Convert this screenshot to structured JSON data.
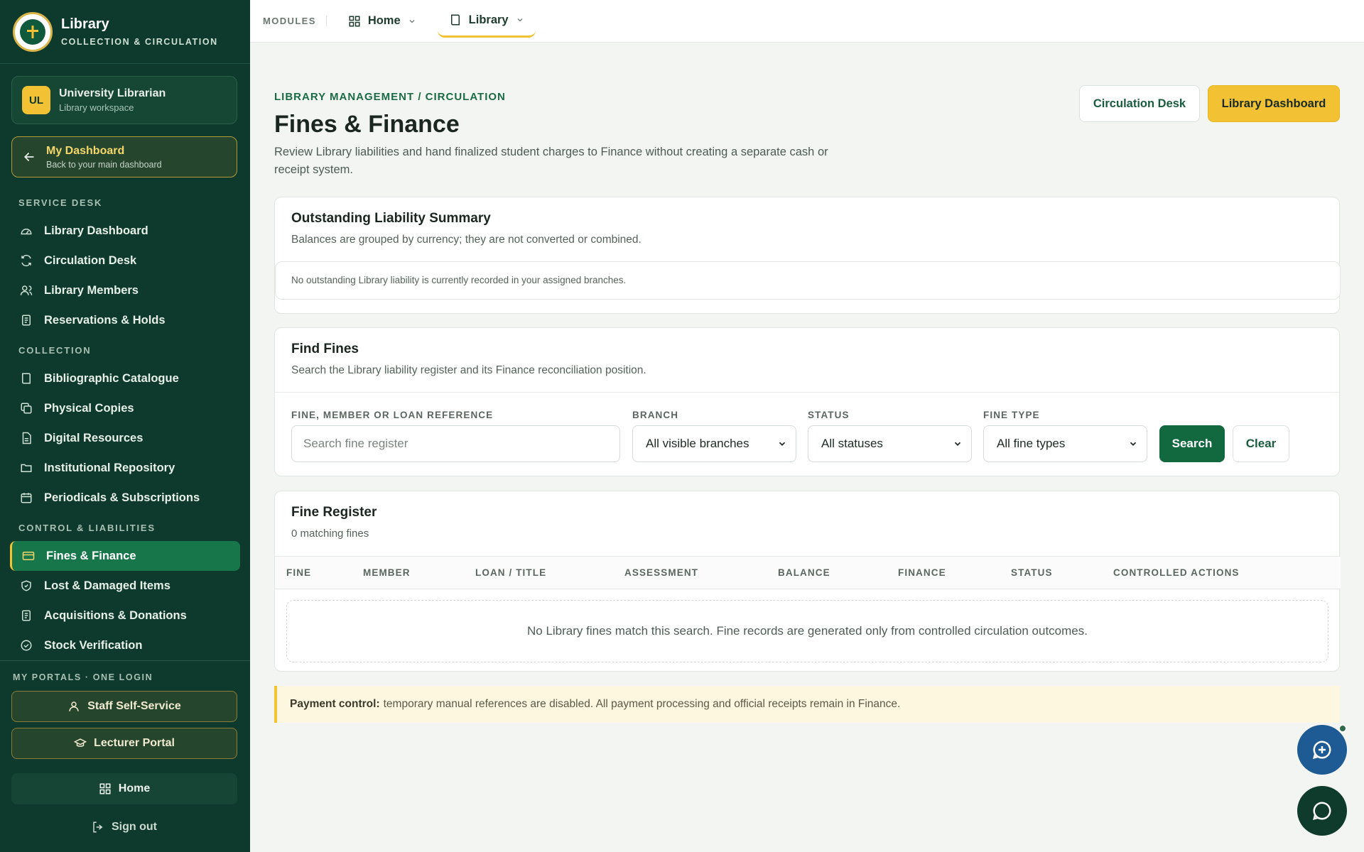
{
  "brand": {
    "title": "Library",
    "subtitle": "COLLECTION & CIRCULATION"
  },
  "user": {
    "initials": "UL",
    "name": "University Librarian",
    "workspace": "Library workspace"
  },
  "dashboard_button": {
    "title": "My Dashboard",
    "subtitle": "Back to your main dashboard"
  },
  "sidebar": {
    "sections": [
      {
        "label": "SERVICE DESK",
        "items": [
          "Library Dashboard",
          "Circulation Desk",
          "Library Members",
          "Reservations & Holds"
        ]
      },
      {
        "label": "COLLECTION",
        "items": [
          "Bibliographic Catalogue",
          "Physical Copies",
          "Digital Resources",
          "Institutional Repository",
          "Periodicals & Subscriptions"
        ]
      },
      {
        "label": "CONTROL & LIABILITIES",
        "items": [
          "Fines & Finance",
          "Lost & Damaged Items",
          "Acquisitions & Donations",
          "Stock Verification"
        ]
      }
    ],
    "active_item": "Fines & Finance"
  },
  "portals": {
    "label": "MY PORTALS · ONE LOGIN",
    "staff": "Staff Self-Service",
    "lecturer": "Lecturer Portal",
    "home": "Home",
    "signout": "Sign out"
  },
  "topbar": {
    "modules_label": "MODULES",
    "tabs": [
      "Home",
      "Library"
    ],
    "active_tab": "Library"
  },
  "header": {
    "breadcrumb": "LIBRARY MANAGEMENT / CIRCULATION",
    "title": "Fines & Finance",
    "description": "Review Library liabilities and hand finalized student charges to Finance without creating a separate cash or receipt system.",
    "circulation_button": "Circulation Desk",
    "dashboard_button": "Library Dashboard"
  },
  "summary": {
    "title": "Outstanding Liability Summary",
    "subtitle": "Balances are grouped by currency; they are not converted or combined.",
    "note": "No outstanding Library liability is currently recorded in your assigned branches."
  },
  "find": {
    "title": "Find Fines",
    "subtitle": "Search the Library liability register and its Finance reconciliation position.",
    "reference_label": "FINE, MEMBER OR LOAN REFERENCE",
    "reference_placeholder": "Search fine register",
    "reference_value": "",
    "branch_label": "BRANCH",
    "branch_value": "All visible branches",
    "status_label": "STATUS",
    "status_value": "All statuses",
    "type_label": "FINE TYPE",
    "type_value": "All fine types",
    "search_button": "Search",
    "clear_button": "Clear"
  },
  "register": {
    "title": "Fine Register",
    "count": "0 matching fines",
    "columns": [
      "FINE",
      "MEMBER",
      "LOAN / TITLE",
      "ASSESSMENT",
      "BALANCE",
      "FINANCE",
      "STATUS",
      "CONTROLLED ACTIONS"
    ],
    "empty_message": "No Library fines match this search. Fine records are generated only from controlled circulation outcomes."
  },
  "notice": {
    "label": "Payment control:",
    "text": "temporary manual references are disabled. All payment processing and official receipts remain in Finance."
  },
  "colors": {
    "sidebar": "#0d3a2c",
    "accent": "#f3c234",
    "primary": "#12683f",
    "active_nav": "#17774b"
  }
}
